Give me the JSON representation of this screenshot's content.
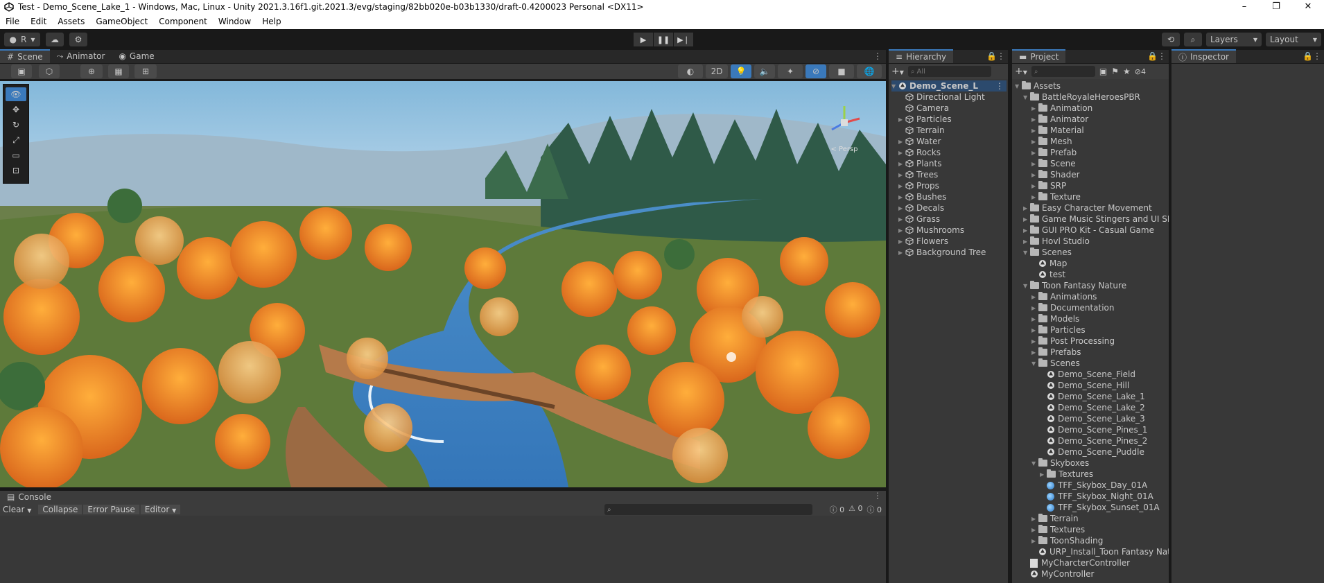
{
  "window": {
    "title": "Test - Demo_Scene_Lake_1 - Windows, Mac, Linux - Unity 2021.3.16f1.git.2021.3/evg/staging/82bb020e-b03b1330/draft-0.4200023 Personal <DX11>",
    "minimize": "–",
    "maximize": "❐",
    "close": "✕"
  },
  "menu": [
    "File",
    "Edit",
    "Assets",
    "GameObject",
    "Component",
    "Window",
    "Help"
  ],
  "toolbar": {
    "account": "R",
    "layers_label": "Layers",
    "layout_label": "Layout"
  },
  "scene_tabs": {
    "scene": "Scene",
    "animator": "Animator",
    "game": "Game"
  },
  "scene_toolbar": {
    "mode_2d": "2D"
  },
  "gizmo": {
    "label": "< Persp"
  },
  "hierarchy": {
    "tab": "Hierarchy",
    "search_placeholder": "All",
    "root": "Demo_Scene_L",
    "items": [
      {
        "label": "Directional Light",
        "arrow": false
      },
      {
        "label": "Camera",
        "arrow": false
      },
      {
        "label": "Particles",
        "arrow": true
      },
      {
        "label": "Terrain",
        "arrow": false
      },
      {
        "label": "Water",
        "arrow": true
      },
      {
        "label": "Rocks",
        "arrow": true
      },
      {
        "label": "Plants",
        "arrow": true
      },
      {
        "label": "Trees",
        "arrow": true
      },
      {
        "label": "Props",
        "arrow": true
      },
      {
        "label": "Bushes",
        "arrow": true
      },
      {
        "label": "Decals",
        "arrow": true
      },
      {
        "label": "Grass",
        "arrow": true
      },
      {
        "label": "Mushrooms",
        "arrow": true
      },
      {
        "label": "Flowers",
        "arrow": true
      },
      {
        "label": "Background Tree",
        "arrow": true
      }
    ]
  },
  "project": {
    "tab": "Project",
    "hidden_count": "4",
    "items": [
      {
        "label": "Assets",
        "depth": 0,
        "type": "folder",
        "arrow": "down"
      },
      {
        "label": "BattleRoyaleHeroesPBR",
        "depth": 1,
        "type": "folder",
        "arrow": "down"
      },
      {
        "label": "Animation",
        "depth": 2,
        "type": "folder",
        "arrow": "right"
      },
      {
        "label": "Animator",
        "depth": 2,
        "type": "folder",
        "arrow": "right"
      },
      {
        "label": "Material",
        "depth": 2,
        "type": "folder",
        "arrow": "right"
      },
      {
        "label": "Mesh",
        "depth": 2,
        "type": "folder",
        "arrow": "right"
      },
      {
        "label": "Prefab",
        "depth": 2,
        "type": "folder",
        "arrow": "right"
      },
      {
        "label": "Scene",
        "depth": 2,
        "type": "folder",
        "arrow": "right"
      },
      {
        "label": "Shader",
        "depth": 2,
        "type": "folder",
        "arrow": "right"
      },
      {
        "label": "SRP",
        "depth": 2,
        "type": "folder",
        "arrow": "right"
      },
      {
        "label": "Texture",
        "depth": 2,
        "type": "folder",
        "arrow": "right"
      },
      {
        "label": "Easy Character Movement",
        "depth": 1,
        "type": "folder",
        "arrow": "right"
      },
      {
        "label": "Game Music Stingers and UI SFX",
        "depth": 1,
        "type": "folder",
        "arrow": "right"
      },
      {
        "label": "GUI PRO Kit - Casual Game",
        "depth": 1,
        "type": "folder",
        "arrow": "right"
      },
      {
        "label": "Hovl Studio",
        "depth": 1,
        "type": "folder",
        "arrow": "right"
      },
      {
        "label": "Scenes",
        "depth": 1,
        "type": "folder",
        "arrow": "down"
      },
      {
        "label": "Map",
        "depth": 2,
        "type": "unity",
        "arrow": ""
      },
      {
        "label": "test",
        "depth": 2,
        "type": "unity",
        "arrow": ""
      },
      {
        "label": "Toon Fantasy Nature",
        "depth": 1,
        "type": "folder",
        "arrow": "down"
      },
      {
        "label": "Animations",
        "depth": 2,
        "type": "folder",
        "arrow": "right"
      },
      {
        "label": "Documentation",
        "depth": 2,
        "type": "folder",
        "arrow": "right"
      },
      {
        "label": "Models",
        "depth": 2,
        "type": "folder",
        "arrow": "right"
      },
      {
        "label": "Particles",
        "depth": 2,
        "type": "folder",
        "arrow": "right"
      },
      {
        "label": "Post Processing",
        "depth": 2,
        "type": "folder",
        "arrow": "right"
      },
      {
        "label": "Prefabs",
        "depth": 2,
        "type": "folder",
        "arrow": "right"
      },
      {
        "label": "Scenes",
        "depth": 2,
        "type": "folder",
        "arrow": "down"
      },
      {
        "label": "Demo_Scene_Field",
        "depth": 3,
        "type": "unity",
        "arrow": ""
      },
      {
        "label": "Demo_Scene_Hill",
        "depth": 3,
        "type": "unity",
        "arrow": ""
      },
      {
        "label": "Demo_Scene_Lake_1",
        "depth": 3,
        "type": "unity",
        "arrow": ""
      },
      {
        "label": "Demo_Scene_Lake_2",
        "depth": 3,
        "type": "unity",
        "arrow": ""
      },
      {
        "label": "Demo_Scene_Lake_3",
        "depth": 3,
        "type": "unity",
        "arrow": ""
      },
      {
        "label": "Demo_Scene_Pines_1",
        "depth": 3,
        "type": "unity",
        "arrow": ""
      },
      {
        "label": "Demo_Scene_Pines_2",
        "depth": 3,
        "type": "unity",
        "arrow": ""
      },
      {
        "label": "Demo_Scene_Puddle",
        "depth": 3,
        "type": "unity",
        "arrow": ""
      },
      {
        "label": "Skyboxes",
        "depth": 2,
        "type": "folder",
        "arrow": "down"
      },
      {
        "label": "Textures",
        "depth": 3,
        "type": "folder",
        "arrow": "right"
      },
      {
        "label": "TFF_Skybox_Day_01A",
        "depth": 3,
        "type": "sky",
        "arrow": ""
      },
      {
        "label": "TFF_Skybox_Night_01A",
        "depth": 3,
        "type": "sky",
        "arrow": ""
      },
      {
        "label": "TFF_Skybox_Sunset_01A",
        "depth": 3,
        "type": "sky",
        "arrow": ""
      },
      {
        "label": "Terrain",
        "depth": 2,
        "type": "folder",
        "arrow": "right"
      },
      {
        "label": "Textures",
        "depth": 2,
        "type": "folder",
        "arrow": "right"
      },
      {
        "label": "ToonShading",
        "depth": 2,
        "type": "folder",
        "arrow": "right"
      },
      {
        "label": "URP_Install_Toon Fantasy Nat",
        "depth": 2,
        "type": "unity",
        "arrow": ""
      },
      {
        "label": "MyCharcterController",
        "depth": 1,
        "type": "script",
        "arrow": ""
      },
      {
        "label": "MyController",
        "depth": 1,
        "type": "unity",
        "arrow": ""
      }
    ]
  },
  "inspector": {
    "tab": "Inspector"
  },
  "console": {
    "tab": "Console",
    "clear": "Clear",
    "collapse": "Collapse",
    "error_pause": "Error Pause",
    "editor": "Editor",
    "log_count": "0",
    "warn_count": "0",
    "error_count": "0"
  },
  "colors": {
    "accent": "#3a79bb",
    "panel": "#383838",
    "tabbar": "#282828"
  }
}
